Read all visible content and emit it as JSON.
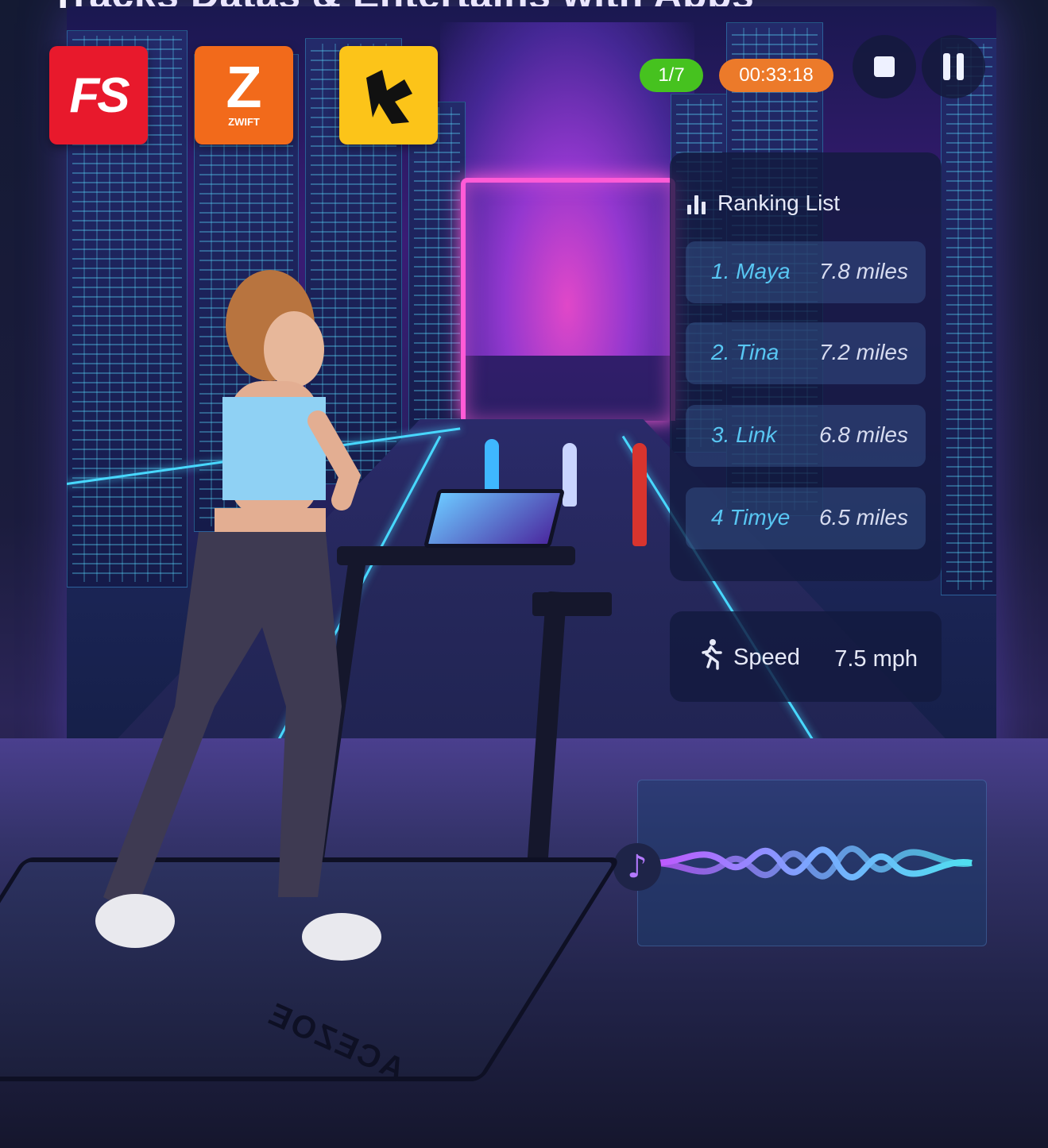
{
  "headline": "Tracks Datas & Entertains with Apps",
  "apps": [
    {
      "name": "FS",
      "icon": "fs-app-logo",
      "color": "#e8192c"
    },
    {
      "name": "ZWIFT",
      "glyph": "Z",
      "icon": "zwift-app-logo",
      "color": "#f26a1b"
    },
    {
      "name": "Kinomap",
      "icon": "kinomap-app-logo",
      "color": "#fcc419"
    }
  ],
  "hud": {
    "lap": "1/7",
    "timer": "00:33:18",
    "stop_icon": "stop-icon",
    "pause_icon": "pause-icon"
  },
  "ranking": {
    "title": "Ranking List",
    "icon": "bar-chart-icon",
    "rows": [
      {
        "name": "1. Maya",
        "distance": "7.8 miles"
      },
      {
        "name": "2. Tina",
        "distance": "7.2 miles"
      },
      {
        "name": "3. Link",
        "distance": "6.8 miles"
      },
      {
        "name": "4 Timye",
        "distance": "6.5 miles"
      }
    ]
  },
  "speed": {
    "label": "Speed",
    "value": "7.5 mph",
    "icon": "runner-icon"
  },
  "audio": {
    "icon": "music-note-icon"
  },
  "treadmill": {
    "brand": "ACEZOE"
  },
  "colors": {
    "neon_cyan": "#48d8ff",
    "neon_pink": "#ff5bd6",
    "rank_name": "#58c6f2",
    "lap_pill": "#46c21f",
    "timer_pill": "#ec7a2a"
  }
}
